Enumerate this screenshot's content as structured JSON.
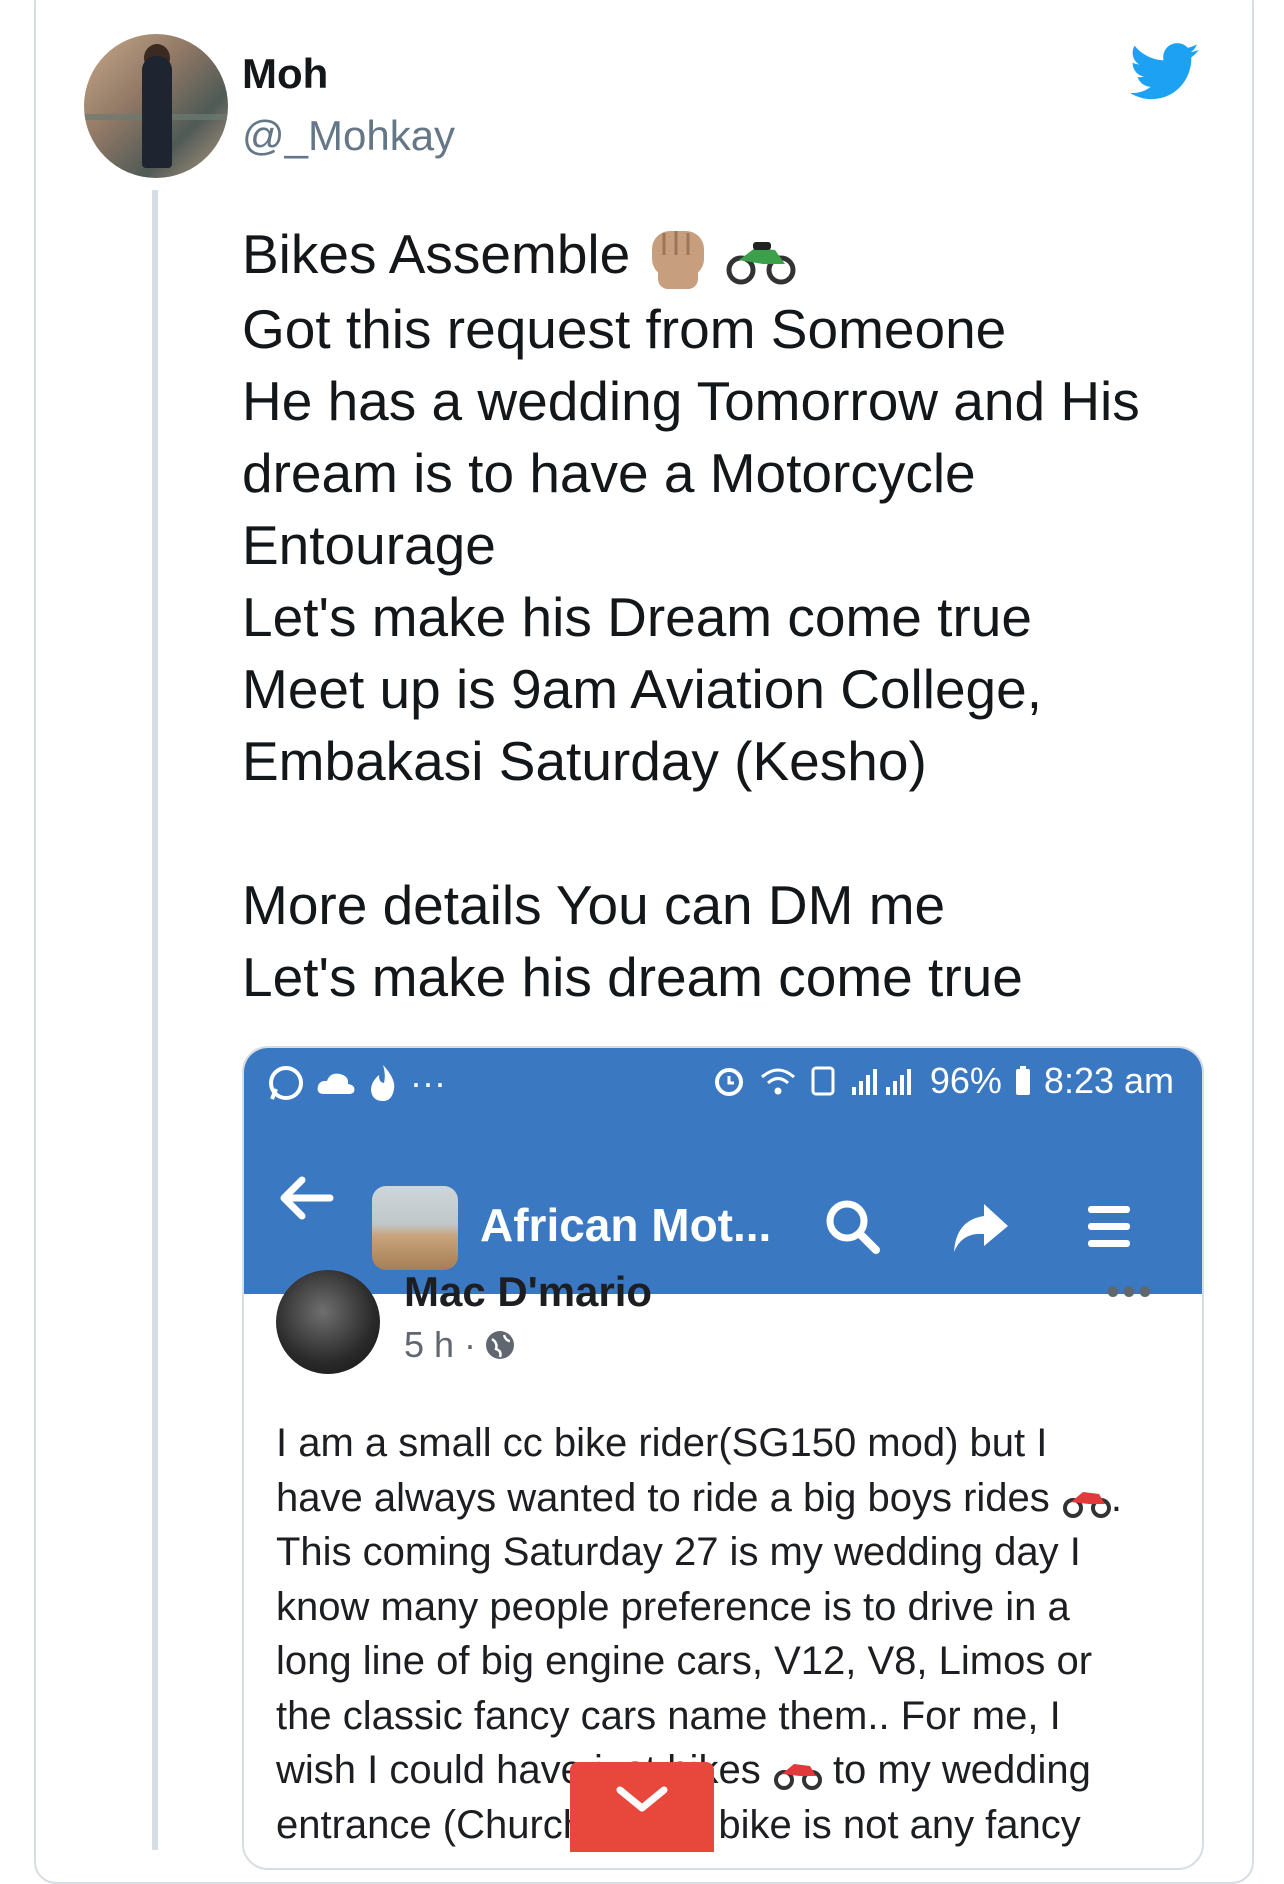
{
  "tweet": {
    "name": "Moh",
    "handle": "@_Mohkay",
    "lines": [
      "Bikes Assemble",
      "Got this request from Someone",
      "He has a wedding Tomorrow and His",
      "dream is to have a Motorcycle",
      "Entourage",
      "Let's make his Dream come true",
      "Meet up is 9am Aviation College,",
      "Embakasi Saturday (Kesho)",
      "",
      "More details You can DM me",
      "Let's make his dream come true"
    ]
  },
  "screenshot": {
    "status": {
      "battery": "96%",
      "time": "8:23 am",
      "dots": "···"
    },
    "appbar": {
      "title": "African Mot..."
    },
    "post": {
      "author": "Mac D'mario",
      "time": "5 h ·",
      "more": "•••",
      "lines": [
        "I am a small cc bike rider(SG150 mod) but I",
        "have always wanted to ride a big boys rides",
        "This coming Saturday 27 is my wedding day I",
        "know many people preference is to drive in a",
        "long line of big engine cars, V12, V8, Limos or",
        "the classic fancy cars name them.. For me, I",
        "wish I could have just bikes",
        "entrance (Church) ... my bike is not any fancy"
      ],
      "line2_suffix": ".",
      "line7_suffix": "to my wedding"
    }
  },
  "colors": {
    "twitter_blue": "#1da1f2",
    "fb_blue": "#3b78c2",
    "expand_red": "#e8473b"
  }
}
